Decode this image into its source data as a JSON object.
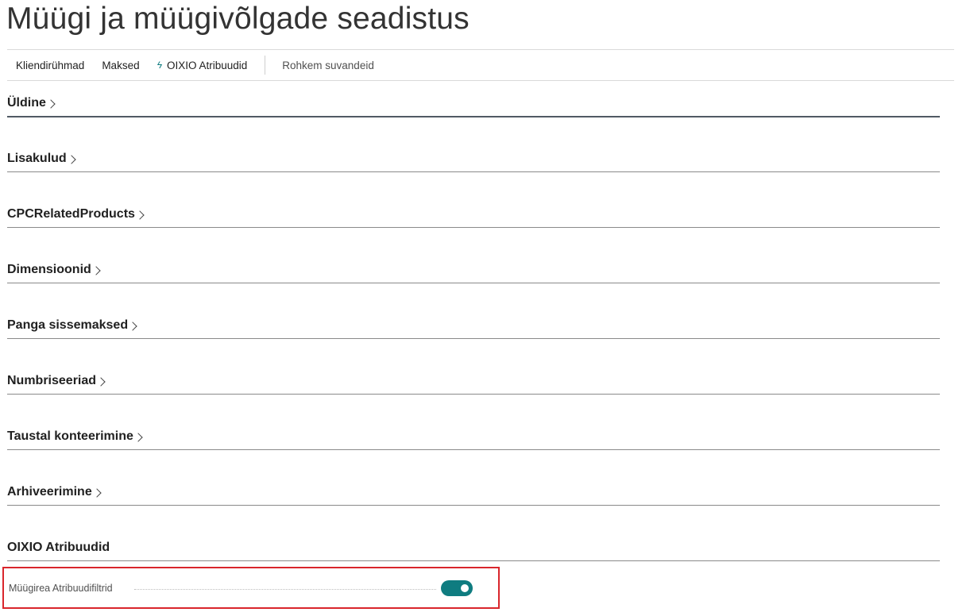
{
  "page": {
    "title": "Müügi ja müügivõlgade seadistus"
  },
  "actions": {
    "customer_groups": "Kliendirühmad",
    "payments": "Maksed",
    "oixio_attributes": "OIXIO Atribuudid",
    "more_options": "Rohkem suvandeid"
  },
  "sections": [
    {
      "title": "Üldine",
      "collapsed": true
    },
    {
      "title": "Lisakulud",
      "collapsed": true
    },
    {
      "title": "CPCRelatedProducts",
      "collapsed": true
    },
    {
      "title": "Dimensioonid",
      "collapsed": true
    },
    {
      "title": "Panga sissemaksed",
      "collapsed": true
    },
    {
      "title": "Numbriseeriad",
      "collapsed": true
    },
    {
      "title": "Taustal konteerimine",
      "collapsed": true
    },
    {
      "title": "Arhiveerimine",
      "collapsed": true
    },
    {
      "title": "OIXIO Atribuudid",
      "collapsed": false
    }
  ],
  "fields": {
    "sales_line_attribute_filters": {
      "label": "Müügirea Atribuudifiltrid",
      "value": true
    }
  },
  "colors": {
    "accent": "#0f7c80",
    "highlight_border": "#d9262c"
  },
  "icons": {
    "oixio_action": "bolt-icon",
    "section_expand": "chevron-right-icon"
  }
}
